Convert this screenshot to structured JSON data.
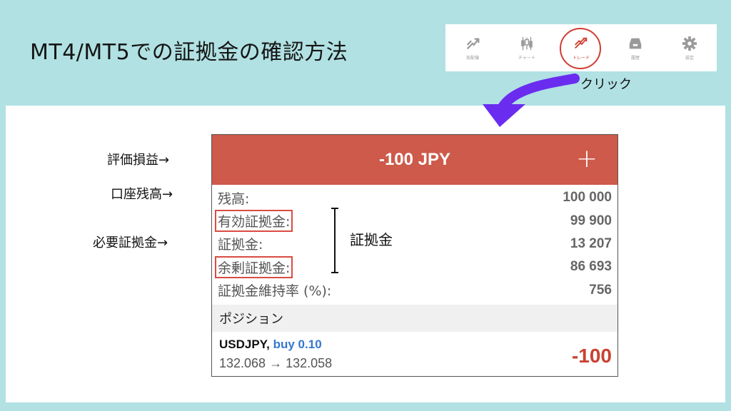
{
  "title": "MT4/MT5での証拠金の確認方法",
  "nav": {
    "items": [
      {
        "label": "気配値",
        "icon": "quotes-icon"
      },
      {
        "label": "チャート",
        "icon": "candlestick-chart-icon"
      },
      {
        "label": "トレード",
        "icon": "trade-icon"
      },
      {
        "label": "履歴",
        "icon": "history-inbox-icon"
      },
      {
        "label": "設定",
        "icon": "gear-icon"
      }
    ],
    "highlighted": "トレード"
  },
  "click_label": "クリック",
  "side_labels": {
    "pnl": "評価損益→",
    "balance": "口座残高→",
    "required_margin": "必要証拠金→"
  },
  "bracket_label": "証拠金",
  "card": {
    "header_value": "-100 JPY",
    "plus": "+",
    "rows": [
      {
        "label": "残高:",
        "value": "100 000"
      },
      {
        "label": "有効証拠金:",
        "value": "99 900"
      },
      {
        "label": "証拠金:",
        "value": "13 207"
      },
      {
        "label": "余剰証拠金:",
        "value": "86 693"
      },
      {
        "label": "証拠金維持率 (%):",
        "value": "756"
      }
    ],
    "positions_header": "ポジション",
    "position": {
      "symbol": "USDJPY,",
      "side": "buy 0.10",
      "prices": "132.068 → 132.058",
      "pl": "-100"
    }
  },
  "colors": {
    "banner": "#b1e1e3",
    "header": "#cd5a4a",
    "highlight": "#d23c32",
    "arrow": "#6a2df0",
    "buy": "#3577cc",
    "loss": "#c94232"
  }
}
